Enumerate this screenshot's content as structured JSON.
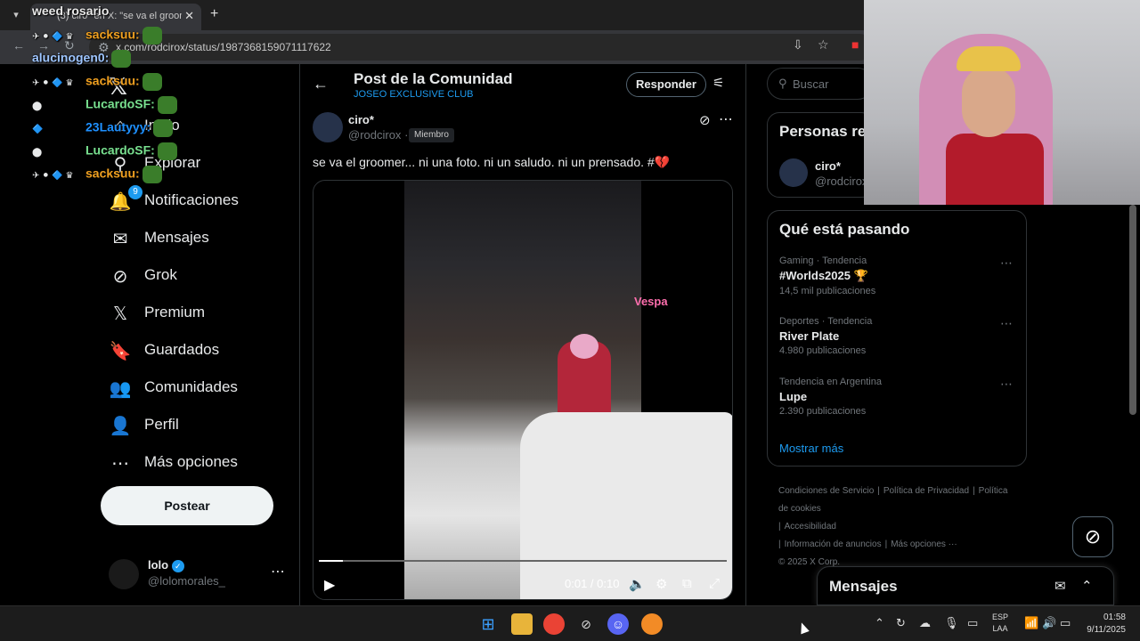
{
  "browser": {
    "tab_title": "(3) ciro* en X: \"se va el groomer",
    "url": "x.com/rodcirox/status/1987368159071117622",
    "new_tab": "+",
    "close_tab": "✕"
  },
  "chat": [
    {
      "badges": "",
      "user": "weed rosario",
      "sep": "",
      "color": "#e9e9e9"
    },
    {
      "badges": "✈ ⚫ 🔷 ♛",
      "user": "sacksuu",
      "sep": ":",
      "color": "#f0a020"
    },
    {
      "badges": "",
      "user": "alucinogen0",
      "sep": ":",
      "color": "#9ec5ff"
    },
    {
      "badges": "✈ ⚫ 🔷 ♛",
      "user": "sacksuu",
      "sep": ":",
      "color": "#f0a020"
    },
    {
      "badges": "⬤",
      "user": "LucardoSF",
      "sep": ":",
      "color": "#78e08f"
    },
    {
      "badges": "🔷",
      "user": "23Lautyyy",
      "sep": ":",
      "color": "#1e90ff"
    },
    {
      "badges": "⬤",
      "user": "LucardoSF",
      "sep": ":",
      "color": "#78e08f"
    },
    {
      "badges": "✈ ⚫ 🔷 ♛",
      "user": "sacksuu",
      "sep": ":",
      "color": "#f0a020"
    }
  ],
  "sidebar": {
    "notif_count": "9",
    "items": [
      {
        "label": "Inicio",
        "icon": "⌂"
      },
      {
        "label": "Explorar",
        "icon": "⚲"
      },
      {
        "label": "Notificaciones",
        "icon": "🔔"
      },
      {
        "label": "Mensajes",
        "icon": "✉"
      },
      {
        "label": "Grok",
        "icon": "⊘"
      },
      {
        "label": "Premium",
        "icon": "𝕏"
      },
      {
        "label": "Guardados",
        "icon": "🔖"
      },
      {
        "label": "Comunidades",
        "icon": "👥"
      },
      {
        "label": "Perfil",
        "icon": "👤"
      },
      {
        "label": "Más opciones",
        "icon": "⋯"
      }
    ],
    "post_button": "Postear",
    "account": {
      "name": "lolo",
      "handle": "@lolomorales_"
    }
  },
  "main": {
    "title": "Post de la Comunidad",
    "subtitle": "JOSEO EXCLUSIVE CLUB",
    "reply_button": "Responder",
    "post": {
      "author": "ciro*",
      "handle": "@rodcirox",
      "dot": "·",
      "tag": "Miembro",
      "text": "se va el groomer... ni una foto. ni un saludo. ni un prensado. #💔",
      "neon_sign": "Vespa",
      "video": {
        "time": "0:01 / 0:10",
        "progress": 0.06
      }
    }
  },
  "right": {
    "search_placeholder": "Buscar",
    "people_title": "Personas relevantes",
    "people": {
      "name": "ciro*",
      "handle": "@rodcirox"
    },
    "trends_title": "Qué está pasando",
    "trends": [
      {
        "meta": "Gaming · Tendencia",
        "name": "#Worlds2025 🏆",
        "count": "14,5 mil publicaciones"
      },
      {
        "meta": "Deportes · Tendencia",
        "name": "River Plate",
        "count": "4.980 publicaciones"
      },
      {
        "meta": "Tendencia en Argentina",
        "name": "Lupe",
        "count": "2.390 publicaciones"
      }
    ],
    "show_more": "Mostrar más",
    "footer": [
      "Condiciones de Servicio",
      "|",
      "Política de Privacidad",
      "|",
      "Política de cookies",
      "|",
      "Accesibilidad",
      "|",
      "Información de anuncios",
      "|",
      "Más opciones ···",
      "© 2025 X Corp."
    ],
    "messages_title": "Mensajes"
  },
  "taskbar": {
    "lang_top": "ESP",
    "lang_bottom": "LAA",
    "time": "01:58",
    "date": "9/11/2025"
  },
  "colors": {
    "accent": "#1d9bf0",
    "background": "#000000",
    "border": "#2f3336"
  }
}
